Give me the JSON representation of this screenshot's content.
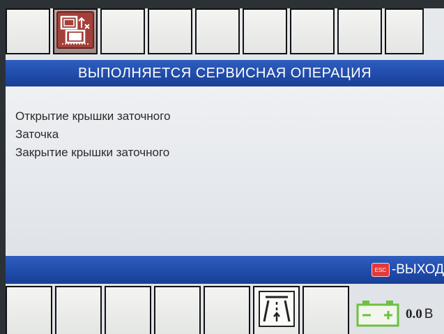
{
  "header": {
    "title": "ВЫПОЛНЯЕТСЯ СЕРВИСНАЯ ОПЕРАЦИЯ"
  },
  "operations": [
    "Открытие крышки заточного",
    "Заточка",
    "Закрытие крышки заточного"
  ],
  "footer": {
    "esc_key_label": "ESC",
    "esc_hint": "-ВЫХОД"
  },
  "status": {
    "battery_voltage": "0.0",
    "voltage_unit": "В"
  },
  "icons": {
    "top_active": "service-operation-icon",
    "bottom_center": "road-lane-icon",
    "battery": "battery-icon"
  },
  "colors": {
    "title_bar": "#1f4aa8",
    "active_key": "#a4403a",
    "esc_key": "#e23a3a",
    "battery": "#6cc13f"
  }
}
